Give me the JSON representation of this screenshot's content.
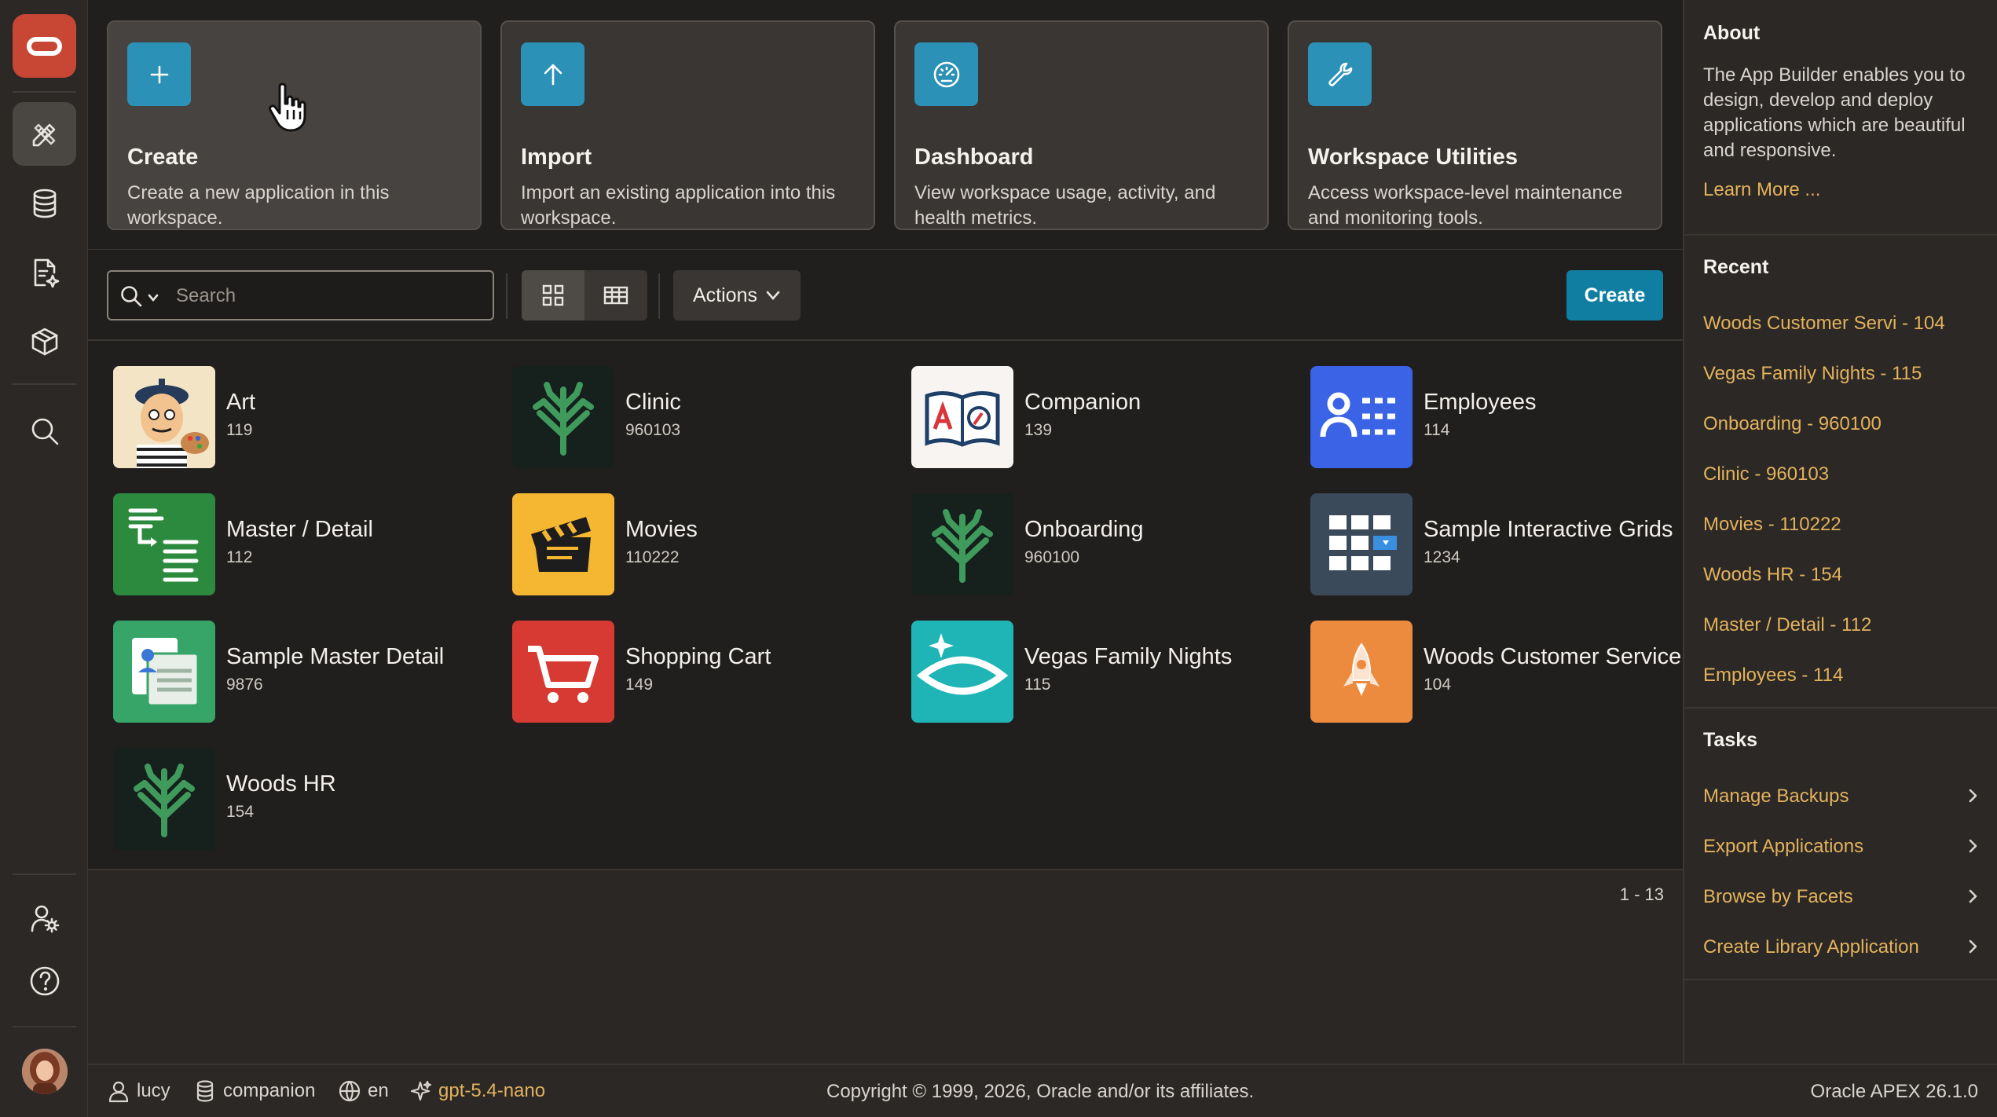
{
  "rail": {
    "logo": "oracle-logo",
    "items": [
      {
        "name": "app-builder",
        "icon": "pencil-ruler-icon",
        "active": true
      },
      {
        "name": "sql-workshop",
        "icon": "database-icon",
        "active": false
      },
      {
        "name": "team-development",
        "icon": "document-sparkle-icon",
        "active": false
      },
      {
        "name": "gallery",
        "icon": "cube-icon",
        "active": false
      },
      {
        "name": "search",
        "icon": "search-icon",
        "active": false
      }
    ],
    "bottom": [
      {
        "name": "administration",
        "icon": "user-gear-icon"
      },
      {
        "name": "help",
        "icon": "help-circle-icon"
      }
    ]
  },
  "cards": [
    {
      "title": "Create",
      "desc": "Create a new application in this workspace.",
      "icon": "plus-icon"
    },
    {
      "title": "Import",
      "desc": "Import an existing application into this workspace.",
      "icon": "arrow-up-icon"
    },
    {
      "title": "Dashboard",
      "desc": "View workspace usage, activity, and health metrics.",
      "icon": "gauge-icon"
    },
    {
      "title": "Workspace Utilities",
      "desc": "Access workspace-level maintenance and monitoring tools.",
      "icon": "wrench-icon"
    }
  ],
  "toolbar": {
    "search_placeholder": "Search",
    "actions_label": "Actions",
    "create_label": "Create"
  },
  "apps": [
    {
      "name": "Art",
      "id": "119",
      "icon": "art-icon",
      "color": "#f3e4c6"
    },
    {
      "name": "Clinic",
      "id": "960103",
      "icon": "tree-icon",
      "color": "#16201d"
    },
    {
      "name": "Companion",
      "id": "139",
      "icon": "book-icon",
      "color": "#f7f4f1"
    },
    {
      "name": "Employees",
      "id": "114",
      "icon": "people-list-icon",
      "color": "#3a63e6"
    },
    {
      "name": "Master / Detail",
      "id": "112",
      "icon": "master-detail-icon",
      "color": "#2b8a3e"
    },
    {
      "name": "Movies",
      "id": "110222",
      "icon": "clapper-icon",
      "color": "#f5b731"
    },
    {
      "name": "Onboarding",
      "id": "960100",
      "icon": "tree-icon",
      "color": "#16201d"
    },
    {
      "name": "Sample Interactive Grids",
      "id": "1234",
      "icon": "grid-icon",
      "color": "#3b4a5a"
    },
    {
      "name": "Sample Master Detail",
      "id": "9876",
      "icon": "contact-card-icon",
      "color": "#36a567"
    },
    {
      "name": "Shopping Cart",
      "id": "149",
      "icon": "cart-icon",
      "color": "#d73a32"
    },
    {
      "name": "Vegas Family Nights",
      "id": "115",
      "icon": "eye-star-icon",
      "color": "#1fb5b6"
    },
    {
      "name": "Woods Customer Service",
      "id": "104",
      "icon": "rocket-icon",
      "color": "#ec8a3e"
    },
    {
      "name": "Woods HR",
      "id": "154",
      "icon": "tree-icon",
      "color": "#16201d"
    }
  ],
  "pager": "1 - 13",
  "about": {
    "title": "About",
    "text": "The App Builder enables you to design, develop and deploy applications which are beautiful and responsive.",
    "link": "Learn More ..."
  },
  "recent": {
    "title": "Recent",
    "items": [
      "Woods Customer Servi - 104",
      "Vegas Family Nights - 115",
      "Onboarding - 960100",
      "Clinic - 960103",
      "Movies - 110222",
      "Woods HR - 154",
      "Master / Detail - 112",
      "Employees - 114"
    ]
  },
  "tasks": {
    "title": "Tasks",
    "items": [
      "Manage Backups",
      "Export Applications",
      "Browse by Facets",
      "Create Library Application"
    ]
  },
  "footer": {
    "user": "lucy",
    "schema": "companion",
    "language": "en",
    "ai_model": "gpt-5.4-nano",
    "copyright": "Copyright © 1999, 2026, Oracle and/or its affiliates.",
    "version": "Oracle APEX 26.1.0"
  },
  "colors": {
    "accent": "#0f7ea1",
    "link": "#e3b25c",
    "card_icon": "#2b91b6",
    "brand": "#c74634"
  }
}
